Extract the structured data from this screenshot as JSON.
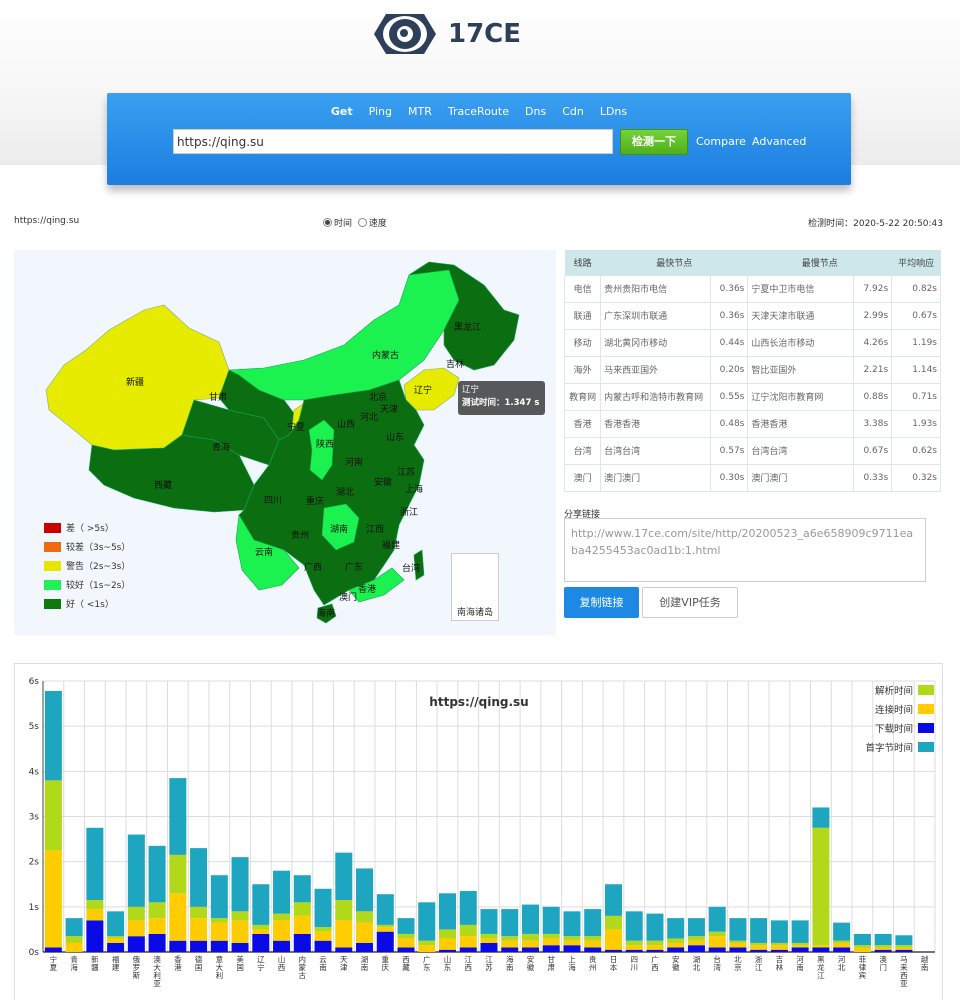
{
  "logo": {
    "text": "17CE"
  },
  "nav": {
    "tabs": [
      "Get",
      "Ping",
      "MTR",
      "TraceRoute",
      "Dns",
      "Cdn",
      "LDns"
    ],
    "active": 0,
    "url_value": "https://qing.su",
    "check_label": "检测一下",
    "compare_label": "Compare",
    "advanced_label": "Advanced"
  },
  "info": {
    "url": "https://qing.su",
    "radio_time": "时间",
    "radio_speed": "速度",
    "check_time": "检测时间：2020-5-22 20:50:43"
  },
  "map": {
    "legend": [
      {
        "label": "差（ >5s）",
        "color": "#cc0000"
      },
      {
        "label": "较差（3s~5s）",
        "color": "#f06a0f"
      },
      {
        "label": "警告（2s~3s）",
        "color": "#e6e600"
      },
      {
        "label": "较好（1s~2s）",
        "color": "#22f055"
      },
      {
        "label": "好（ <1s）",
        "color": "#0c7a0c"
      }
    ],
    "labels": [
      "黑龙江",
      "吉林",
      "辽宁",
      "内蒙古",
      "新疆",
      "甘肃",
      "青海",
      "西藏",
      "宁夏",
      "陕西",
      "山西",
      "北京",
      "天津",
      "河北",
      "山东",
      "河南",
      "江苏",
      "安徽",
      "上海",
      "湖北",
      "四川",
      "重庆",
      "浙江",
      "湖南",
      "江西",
      "贵州",
      "云南",
      "福建",
      "广西",
      "广东",
      "台湾",
      "香港",
      "澳门",
      "海南"
    ],
    "tooltip_title": "辽宁",
    "tooltip_value": "测试时间：1.347 s",
    "nanhai": "南海诸岛",
    "colors": {
      "dark": "#0b6e10",
      "light": "#1cf24f",
      "yellow": "#e6eb00"
    }
  },
  "table": {
    "headers": [
      "线路",
      "最快节点",
      "最慢节点",
      "平均响应"
    ],
    "rows": [
      [
        "电信",
        "贵州贵阳市电信",
        "0.36s",
        "宁夏中卫市电信",
        "7.92s",
        "0.82s"
      ],
      [
        "联通",
        "广东深圳市联通",
        "0.36s",
        "天津天津市联通",
        "2.99s",
        "0.67s"
      ],
      [
        "移动",
        "湖北黄冈市移动",
        "0.44s",
        "山西长治市移动",
        "4.26s",
        "1.19s"
      ],
      [
        "海外",
        "马来西亚国外",
        "0.20s",
        "智比亚国外",
        "2.21s",
        "1.14s"
      ],
      [
        "教育网",
        "内蒙古呼和浩特市教育网",
        "0.55s",
        "辽宁沈阳市教育网",
        "0.88s",
        "0.71s"
      ],
      [
        "香港",
        "香港香港",
        "0.48s",
        "香港香港",
        "3.38s",
        "1.93s"
      ],
      [
        "台湾",
        "台湾台湾",
        "0.57s",
        "台湾台湾",
        "0.67s",
        "0.62s"
      ],
      [
        "澳门",
        "澳门澳门",
        "0.30s",
        "澳门澳门",
        "0.33s",
        "0.32s"
      ]
    ]
  },
  "share": {
    "label": "分享链接",
    "url": "http://www.17ce.com/site/http/20200523_a6e658909c9711eaba4255453ac0ad1b:1.html",
    "copy_label": "复制链接",
    "vip_label": "创建VIP任务"
  },
  "chart_data": {
    "type": "bar",
    "title": "https://qing.su",
    "ylim": [
      0,
      6
    ],
    "yticks": [
      "0s",
      "1s",
      "2s",
      "3s",
      "4s",
      "5s",
      "6s"
    ],
    "legend_position": "top-right",
    "series": [
      {
        "name": "解析时间",
        "color": "#b2d81a"
      },
      {
        "name": "连接时间",
        "color": "#ffcc00"
      },
      {
        "name": "下载时间",
        "color": "#0a0ae6"
      },
      {
        "name": "首字节时间",
        "color": "#1ea6c0"
      }
    ],
    "categories": [
      "宁夏",
      "青海",
      "新疆",
      "福建",
      "俄罗斯",
      "澳大利亚",
      "香港",
      "德国",
      "意大利",
      "美国",
      "辽宁",
      "山西",
      "内蒙古",
      "云南",
      "天津",
      "湖南",
      "重庆",
      "西藏",
      "广东",
      "山东",
      "江西",
      "江苏",
      "海南",
      "安徽",
      "甘肃",
      "上海",
      "贵州",
      "日本",
      "四川",
      "广西",
      "安徽",
      "湖北",
      "台湾",
      "北京",
      "浙江",
      "吉林",
      "河南",
      "黑龙江",
      "河北",
      "菲律宾",
      "澳门",
      "马来西亚",
      "越南"
    ],
    "stacks": [
      [
        1.55,
        2.15,
        0.1,
        1.98
      ],
      [
        0.15,
        0.2,
        0.0,
        0.4
      ],
      [
        0.2,
        0.25,
        0.7,
        1.6
      ],
      [
        0.05,
        0.1,
        0.2,
        0.55
      ],
      [
        0.3,
        0.35,
        0.35,
        1.6
      ],
      [
        0.35,
        0.35,
        0.4,
        1.25
      ],
      [
        0.85,
        1.05,
        0.25,
        1.7
      ],
      [
        0.25,
        0.5,
        0.25,
        1.3
      ],
      [
        0.1,
        0.4,
        0.25,
        0.95
      ],
      [
        0.2,
        0.5,
        0.2,
        1.2
      ],
      [
        0.1,
        0.1,
        0.4,
        0.9
      ],
      [
        0.15,
        0.45,
        0.25,
        0.95
      ],
      [
        0.3,
        0.4,
        0.4,
        0.6
      ],
      [
        0.1,
        0.2,
        0.25,
        0.85
      ],
      [
        0.45,
        0.6,
        0.1,
        1.05
      ],
      [
        0.25,
        0.45,
        0.2,
        0.95
      ],
      [
        0.05,
        0.1,
        0.45,
        0.68
      ],
      [
        0.1,
        0.2,
        0.1,
        0.35
      ],
      [
        0.1,
        0.15,
        0.0,
        0.85
      ],
      [
        0.2,
        0.25,
        0.05,
        0.8
      ],
      [
        0.25,
        0.25,
        0.1,
        0.75
      ],
      [
        0.1,
        0.1,
        0.2,
        0.55
      ],
      [
        0.1,
        0.15,
        0.1,
        0.6
      ],
      [
        0.15,
        0.15,
        0.1,
        0.65
      ],
      [
        0.1,
        0.15,
        0.15,
        0.6
      ],
      [
        0.1,
        0.1,
        0.15,
        0.55
      ],
      [
        0.1,
        0.15,
        0.1,
        0.6
      ],
      [
        0.3,
        0.45,
        0.05,
        0.7
      ],
      [
        0.1,
        0.1,
        0.05,
        0.65
      ],
      [
        0.1,
        0.1,
        0.05,
        0.6
      ],
      [
        0.1,
        0.1,
        0.1,
        0.45
      ],
      [
        0.1,
        0.1,
        0.15,
        0.4
      ],
      [
        0.1,
        0.25,
        0.1,
        0.55
      ],
      [
        0.05,
        0.1,
        0.1,
        0.5
      ],
      [
        0.05,
        0.1,
        0.05,
        0.55
      ],
      [
        0.05,
        0.1,
        0.05,
        0.5
      ],
      [
        0.05,
        0.05,
        0.1,
        0.5
      ],
      [
        2.6,
        0.05,
        0.1,
        0.45
      ],
      [
        0.05,
        0.1,
        0.1,
        0.4
      ],
      [
        0.05,
        0.1,
        0.0,
        0.25
      ],
      [
        0.05,
        0.05,
        0.05,
        0.25
      ],
      [
        0.05,
        0.05,
        0.05,
        0.22
      ],
      [
        0.0,
        0.0,
        0.0,
        0.0
      ]
    ]
  }
}
